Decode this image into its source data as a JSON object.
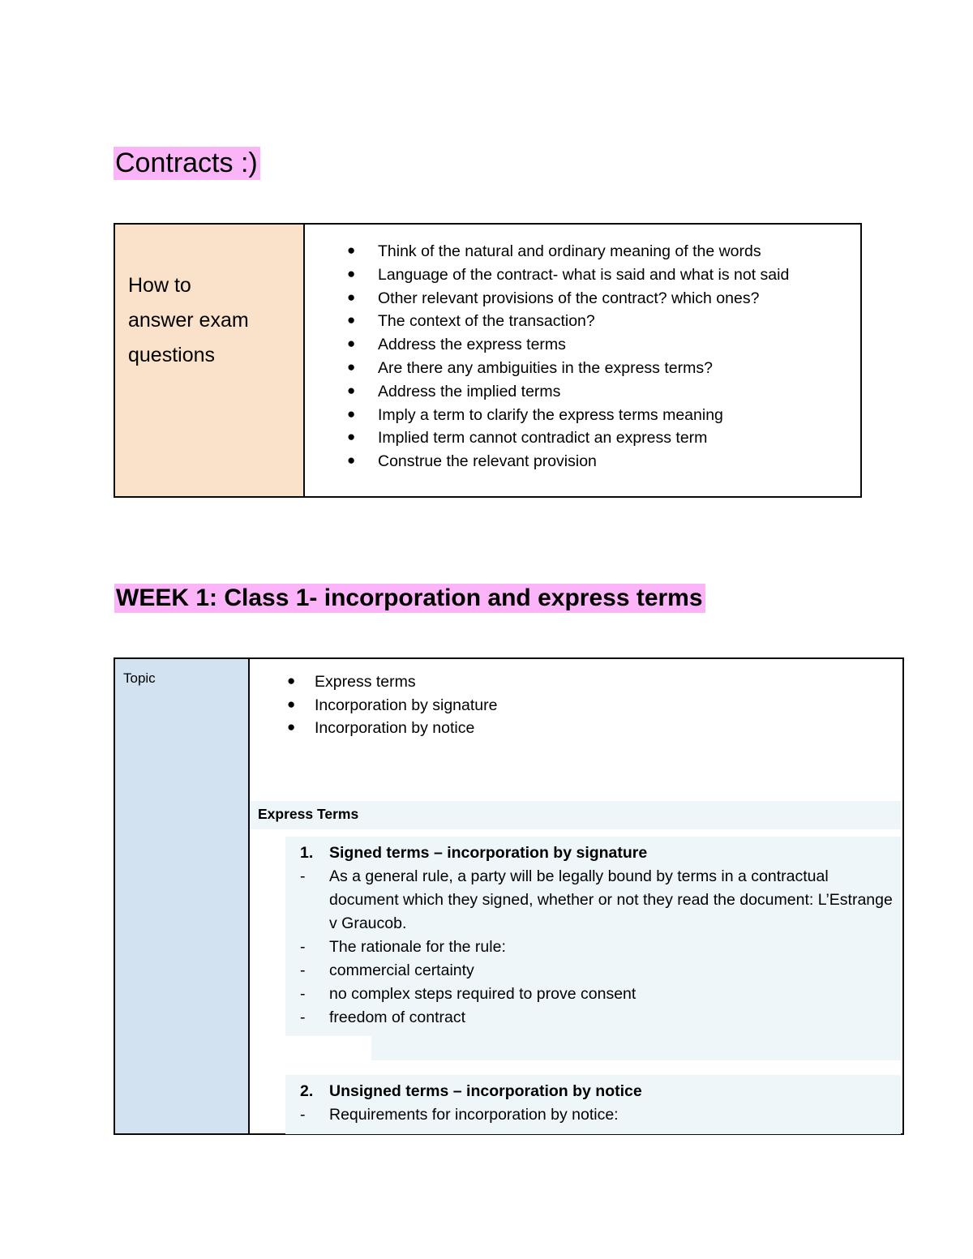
{
  "document": {
    "title": "Contracts :)",
    "highlight_color": "#FBB4F7"
  },
  "exam_table": {
    "left_label": "How to\nanswer exam\nquestions",
    "left_bg": "#FAE1C9",
    "bullet_glyph": "●",
    "bullets": [
      "Think of the natural and ordinary meaning of the words",
      "Language of the contract- what is said and what is not said",
      "Other relevant provisions of the contract? which ones?",
      "The context of the transaction?",
      "Address the express terms",
      "Are there any ambiguities in the express terms?",
      "Address the implied terms",
      "Imply a term to clarify the express terms meaning",
      "Implied term cannot contradict an express term",
      "Construe the relevant provision"
    ]
  },
  "week_heading": "WEEK 1: Class 1- incorporation and express terms",
  "topic_table": {
    "left_label": "Topic",
    "left_bg": "#D3E2F1",
    "shade_color": "#EFF6FA",
    "bullet_glyph": "●",
    "topics": [
      "Express terms",
      "Incorporation by signature",
      "Incorporation by notice"
    ],
    "section_heading": "Express Terms",
    "item1": {
      "marker": "1.",
      "heading": "Signed terms – incorporation by signature",
      "dash_marker": "-",
      "points": [
        "As a general rule, a party will be legally bound by terms in a contractual document which they signed, whether or not they read the document: L’Estrange v Graucob.",
        "The rationale for the rule:",
        "commercial certainty",
        "no complex steps required to prove consent",
        "freedom of contract"
      ]
    },
    "item2": {
      "marker": "2.",
      "heading": "Unsigned terms – incorporation by notice",
      "dash_marker": "-",
      "points": [
        "Requirements for incorporation by notice:"
      ]
    }
  }
}
